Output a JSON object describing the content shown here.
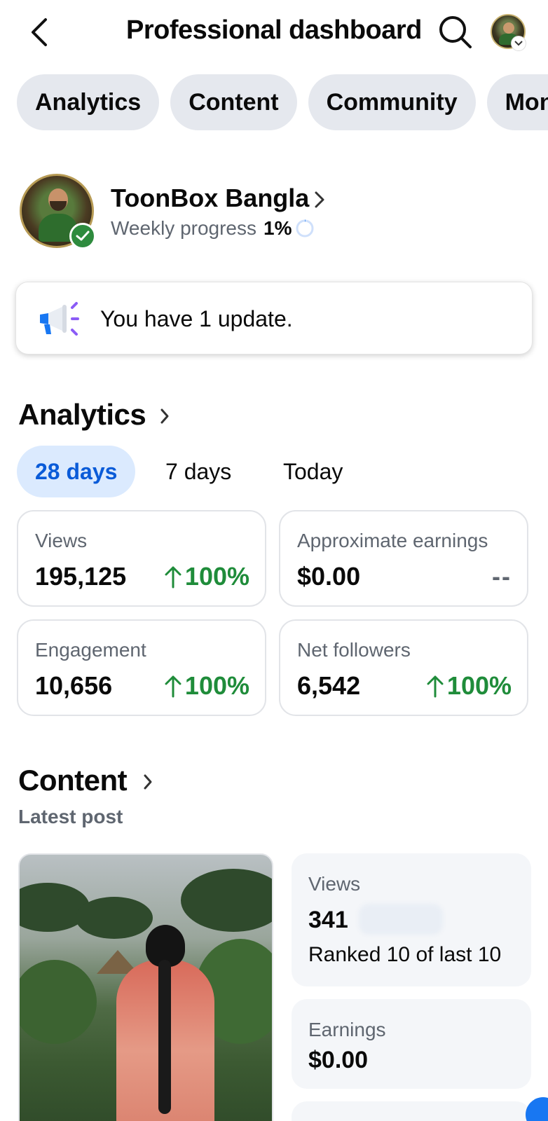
{
  "header": {
    "title": "Professional dashboard",
    "back_icon": "chevron-left-icon",
    "search_icon": "search-icon"
  },
  "tabs": [
    {
      "label": "Analytics"
    },
    {
      "label": "Content"
    },
    {
      "label": "Community"
    },
    {
      "label": "Monet"
    }
  ],
  "profile": {
    "name": "ToonBox Bangla",
    "progress_label": "Weekly progress",
    "progress_value": "1%",
    "progress_fraction": 0.01
  },
  "update_banner": {
    "text": "You have 1 update."
  },
  "analytics": {
    "title": "Analytics",
    "periods": [
      {
        "label": "28 days",
        "active": true
      },
      {
        "label": "7 days",
        "active": false
      },
      {
        "label": "Today",
        "active": false
      }
    ],
    "metrics": [
      {
        "label": "Views",
        "value": "195,125",
        "change": "100%",
        "trend": "up"
      },
      {
        "label": "Approximate earnings",
        "value": "$0.00",
        "change": "--",
        "trend": "none"
      },
      {
        "label": "Engagement",
        "value": "10,656",
        "change": "100%",
        "trend": "up"
      },
      {
        "label": "Net followers",
        "value": "6,542",
        "change": "100%",
        "trend": "up"
      }
    ]
  },
  "content": {
    "title": "Content",
    "subheading": "Latest post",
    "views_label": "Views",
    "views_value": "341",
    "rank_text": "Ranked 10 of last 10",
    "earnings_label": "Earnings",
    "earnings_value": "$0.00"
  },
  "colors": {
    "accent_blue": "#0a5bd8",
    "positive_green": "#1f8c3a",
    "chip_bg": "#e5e8ee",
    "verified_green": "#2e8b3e"
  }
}
